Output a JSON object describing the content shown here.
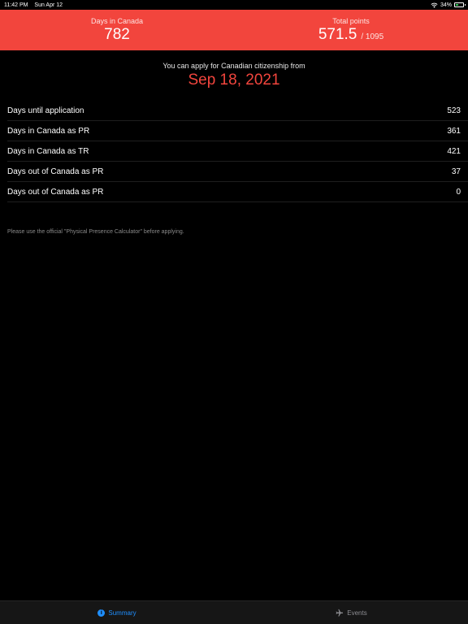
{
  "status_bar": {
    "time": "11:42 PM",
    "date": "Sun Apr 12",
    "battery": "34%"
  },
  "header": {
    "days_label": "Days in Canada",
    "days_value": "782",
    "points_label": "Total points",
    "points_value": "571.5",
    "points_total": "/ 1095"
  },
  "intro": {
    "text": "You can apply for Canadian citizenship from",
    "date": "Sep 18, 2021"
  },
  "stats": [
    {
      "label": "Days until application",
      "value": "523"
    },
    {
      "label": "Days in Canada as PR",
      "value": "361"
    },
    {
      "label": "Days in Canada as TR",
      "value": "421"
    },
    {
      "label": "Days out of Canada as PR",
      "value": "37"
    },
    {
      "label": "Days out of Canada as PR",
      "value": "0"
    }
  ],
  "disclaimer": "Please use the official \"Physical Presence Calculator\" before applying.",
  "tabs": {
    "summary": "Summary",
    "events": "Events"
  },
  "colors": {
    "accent": "#f2453d",
    "tab_active": "#1f8fff",
    "tab_inactive": "#8e8e93"
  },
  "icons": {
    "info": "info-icon",
    "plane": "plane-icon",
    "wifi": "wifi-icon",
    "battery": "battery-icon"
  }
}
